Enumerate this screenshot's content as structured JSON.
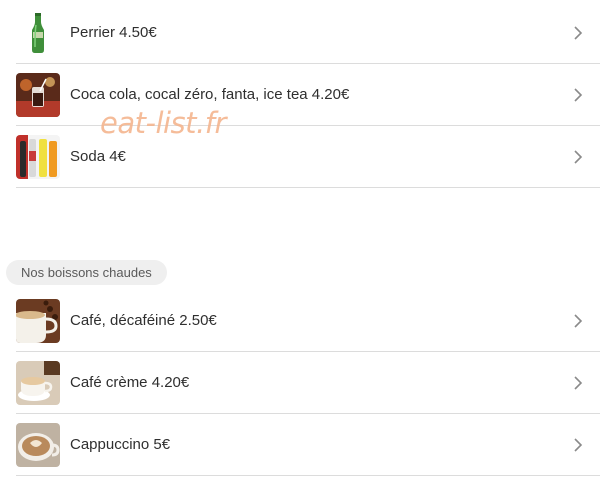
{
  "drinks_cold": [
    {
      "label": "Perrier 4.50€",
      "icon": "bottle-icon"
    },
    {
      "label": "Coca cola, cocal zéro, fanta, ice tea 4.20€",
      "icon": "soda-glass-icon"
    },
    {
      "label": "Soda 4€",
      "icon": "soda-bottles-icon"
    }
  ],
  "watermark": "eat-list.fr",
  "section_hot": "Nos boissons chaudes",
  "drinks_hot": [
    {
      "label": "Café, décaféiné 2.50€",
      "icon": "coffee-cup-icon"
    },
    {
      "label": "Café crème 4.20€",
      "icon": "cafe-creme-icon"
    },
    {
      "label": "Cappuccino 5€",
      "icon": "cappuccino-icon"
    }
  ],
  "colors": {
    "separator": "#dcdcdc",
    "pill_bg": "#efefef",
    "watermark": "#f4b58f",
    "chevron": "#8a8a8a"
  }
}
